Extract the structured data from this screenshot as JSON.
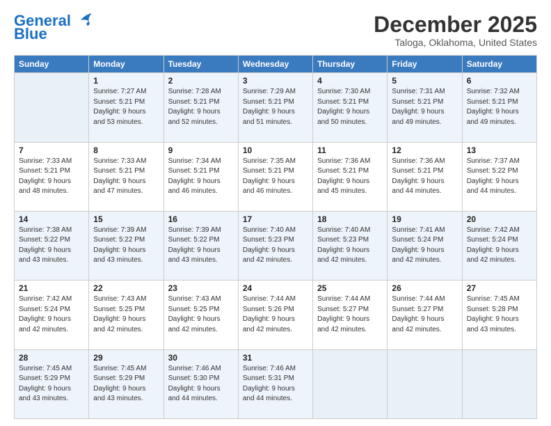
{
  "logo": {
    "line1": "General",
    "line2": "Blue"
  },
  "header": {
    "title": "December 2025",
    "subtitle": "Taloga, Oklahoma, United States"
  },
  "weekdays": [
    "Sunday",
    "Monday",
    "Tuesday",
    "Wednesday",
    "Thursday",
    "Friday",
    "Saturday"
  ],
  "weeks": [
    [
      {
        "day": "",
        "sunrise": "",
        "sunset": "",
        "daylight": ""
      },
      {
        "day": "1",
        "sunrise": "Sunrise: 7:27 AM",
        "sunset": "Sunset: 5:21 PM",
        "daylight": "Daylight: 9 hours and 53 minutes."
      },
      {
        "day": "2",
        "sunrise": "Sunrise: 7:28 AM",
        "sunset": "Sunset: 5:21 PM",
        "daylight": "Daylight: 9 hours and 52 minutes."
      },
      {
        "day": "3",
        "sunrise": "Sunrise: 7:29 AM",
        "sunset": "Sunset: 5:21 PM",
        "daylight": "Daylight: 9 hours and 51 minutes."
      },
      {
        "day": "4",
        "sunrise": "Sunrise: 7:30 AM",
        "sunset": "Sunset: 5:21 PM",
        "daylight": "Daylight: 9 hours and 50 minutes."
      },
      {
        "day": "5",
        "sunrise": "Sunrise: 7:31 AM",
        "sunset": "Sunset: 5:21 PM",
        "daylight": "Daylight: 9 hours and 49 minutes."
      },
      {
        "day": "6",
        "sunrise": "Sunrise: 7:32 AM",
        "sunset": "Sunset: 5:21 PM",
        "daylight": "Daylight: 9 hours and 49 minutes."
      }
    ],
    [
      {
        "day": "7",
        "sunrise": "Sunrise: 7:33 AM",
        "sunset": "Sunset: 5:21 PM",
        "daylight": "Daylight: 9 hours and 48 minutes."
      },
      {
        "day": "8",
        "sunrise": "Sunrise: 7:33 AM",
        "sunset": "Sunset: 5:21 PM",
        "daylight": "Daylight: 9 hours and 47 minutes."
      },
      {
        "day": "9",
        "sunrise": "Sunrise: 7:34 AM",
        "sunset": "Sunset: 5:21 PM",
        "daylight": "Daylight: 9 hours and 46 minutes."
      },
      {
        "day": "10",
        "sunrise": "Sunrise: 7:35 AM",
        "sunset": "Sunset: 5:21 PM",
        "daylight": "Daylight: 9 hours and 46 minutes."
      },
      {
        "day": "11",
        "sunrise": "Sunrise: 7:36 AM",
        "sunset": "Sunset: 5:21 PM",
        "daylight": "Daylight: 9 hours and 45 minutes."
      },
      {
        "day": "12",
        "sunrise": "Sunrise: 7:36 AM",
        "sunset": "Sunset: 5:21 PM",
        "daylight": "Daylight: 9 hours and 44 minutes."
      },
      {
        "day": "13",
        "sunrise": "Sunrise: 7:37 AM",
        "sunset": "Sunset: 5:22 PM",
        "daylight": "Daylight: 9 hours and 44 minutes."
      }
    ],
    [
      {
        "day": "14",
        "sunrise": "Sunrise: 7:38 AM",
        "sunset": "Sunset: 5:22 PM",
        "daylight": "Daylight: 9 hours and 43 minutes."
      },
      {
        "day": "15",
        "sunrise": "Sunrise: 7:39 AM",
        "sunset": "Sunset: 5:22 PM",
        "daylight": "Daylight: 9 hours and 43 minutes."
      },
      {
        "day": "16",
        "sunrise": "Sunrise: 7:39 AM",
        "sunset": "Sunset: 5:22 PM",
        "daylight": "Daylight: 9 hours and 43 minutes."
      },
      {
        "day": "17",
        "sunrise": "Sunrise: 7:40 AM",
        "sunset": "Sunset: 5:23 PM",
        "daylight": "Daylight: 9 hours and 42 minutes."
      },
      {
        "day": "18",
        "sunrise": "Sunrise: 7:40 AM",
        "sunset": "Sunset: 5:23 PM",
        "daylight": "Daylight: 9 hours and 42 minutes."
      },
      {
        "day": "19",
        "sunrise": "Sunrise: 7:41 AM",
        "sunset": "Sunset: 5:24 PM",
        "daylight": "Daylight: 9 hours and 42 minutes."
      },
      {
        "day": "20",
        "sunrise": "Sunrise: 7:42 AM",
        "sunset": "Sunset: 5:24 PM",
        "daylight": "Daylight: 9 hours and 42 minutes."
      }
    ],
    [
      {
        "day": "21",
        "sunrise": "Sunrise: 7:42 AM",
        "sunset": "Sunset: 5:24 PM",
        "daylight": "Daylight: 9 hours and 42 minutes."
      },
      {
        "day": "22",
        "sunrise": "Sunrise: 7:43 AM",
        "sunset": "Sunset: 5:25 PM",
        "daylight": "Daylight: 9 hours and 42 minutes."
      },
      {
        "day": "23",
        "sunrise": "Sunrise: 7:43 AM",
        "sunset": "Sunset: 5:25 PM",
        "daylight": "Daylight: 9 hours and 42 minutes."
      },
      {
        "day": "24",
        "sunrise": "Sunrise: 7:44 AM",
        "sunset": "Sunset: 5:26 PM",
        "daylight": "Daylight: 9 hours and 42 minutes."
      },
      {
        "day": "25",
        "sunrise": "Sunrise: 7:44 AM",
        "sunset": "Sunset: 5:27 PM",
        "daylight": "Daylight: 9 hours and 42 minutes."
      },
      {
        "day": "26",
        "sunrise": "Sunrise: 7:44 AM",
        "sunset": "Sunset: 5:27 PM",
        "daylight": "Daylight: 9 hours and 42 minutes."
      },
      {
        "day": "27",
        "sunrise": "Sunrise: 7:45 AM",
        "sunset": "Sunset: 5:28 PM",
        "daylight": "Daylight: 9 hours and 43 minutes."
      }
    ],
    [
      {
        "day": "28",
        "sunrise": "Sunrise: 7:45 AM",
        "sunset": "Sunset: 5:29 PM",
        "daylight": "Daylight: 9 hours and 43 minutes."
      },
      {
        "day": "29",
        "sunrise": "Sunrise: 7:45 AM",
        "sunset": "Sunset: 5:29 PM",
        "daylight": "Daylight: 9 hours and 43 minutes."
      },
      {
        "day": "30",
        "sunrise": "Sunrise: 7:46 AM",
        "sunset": "Sunset: 5:30 PM",
        "daylight": "Daylight: 9 hours and 44 minutes."
      },
      {
        "day": "31",
        "sunrise": "Sunrise: 7:46 AM",
        "sunset": "Sunset: 5:31 PM",
        "daylight": "Daylight: 9 hours and 44 minutes."
      },
      {
        "day": "",
        "sunrise": "",
        "sunset": "",
        "daylight": ""
      },
      {
        "day": "",
        "sunrise": "",
        "sunset": "",
        "daylight": ""
      },
      {
        "day": "",
        "sunrise": "",
        "sunset": "",
        "daylight": ""
      }
    ]
  ]
}
